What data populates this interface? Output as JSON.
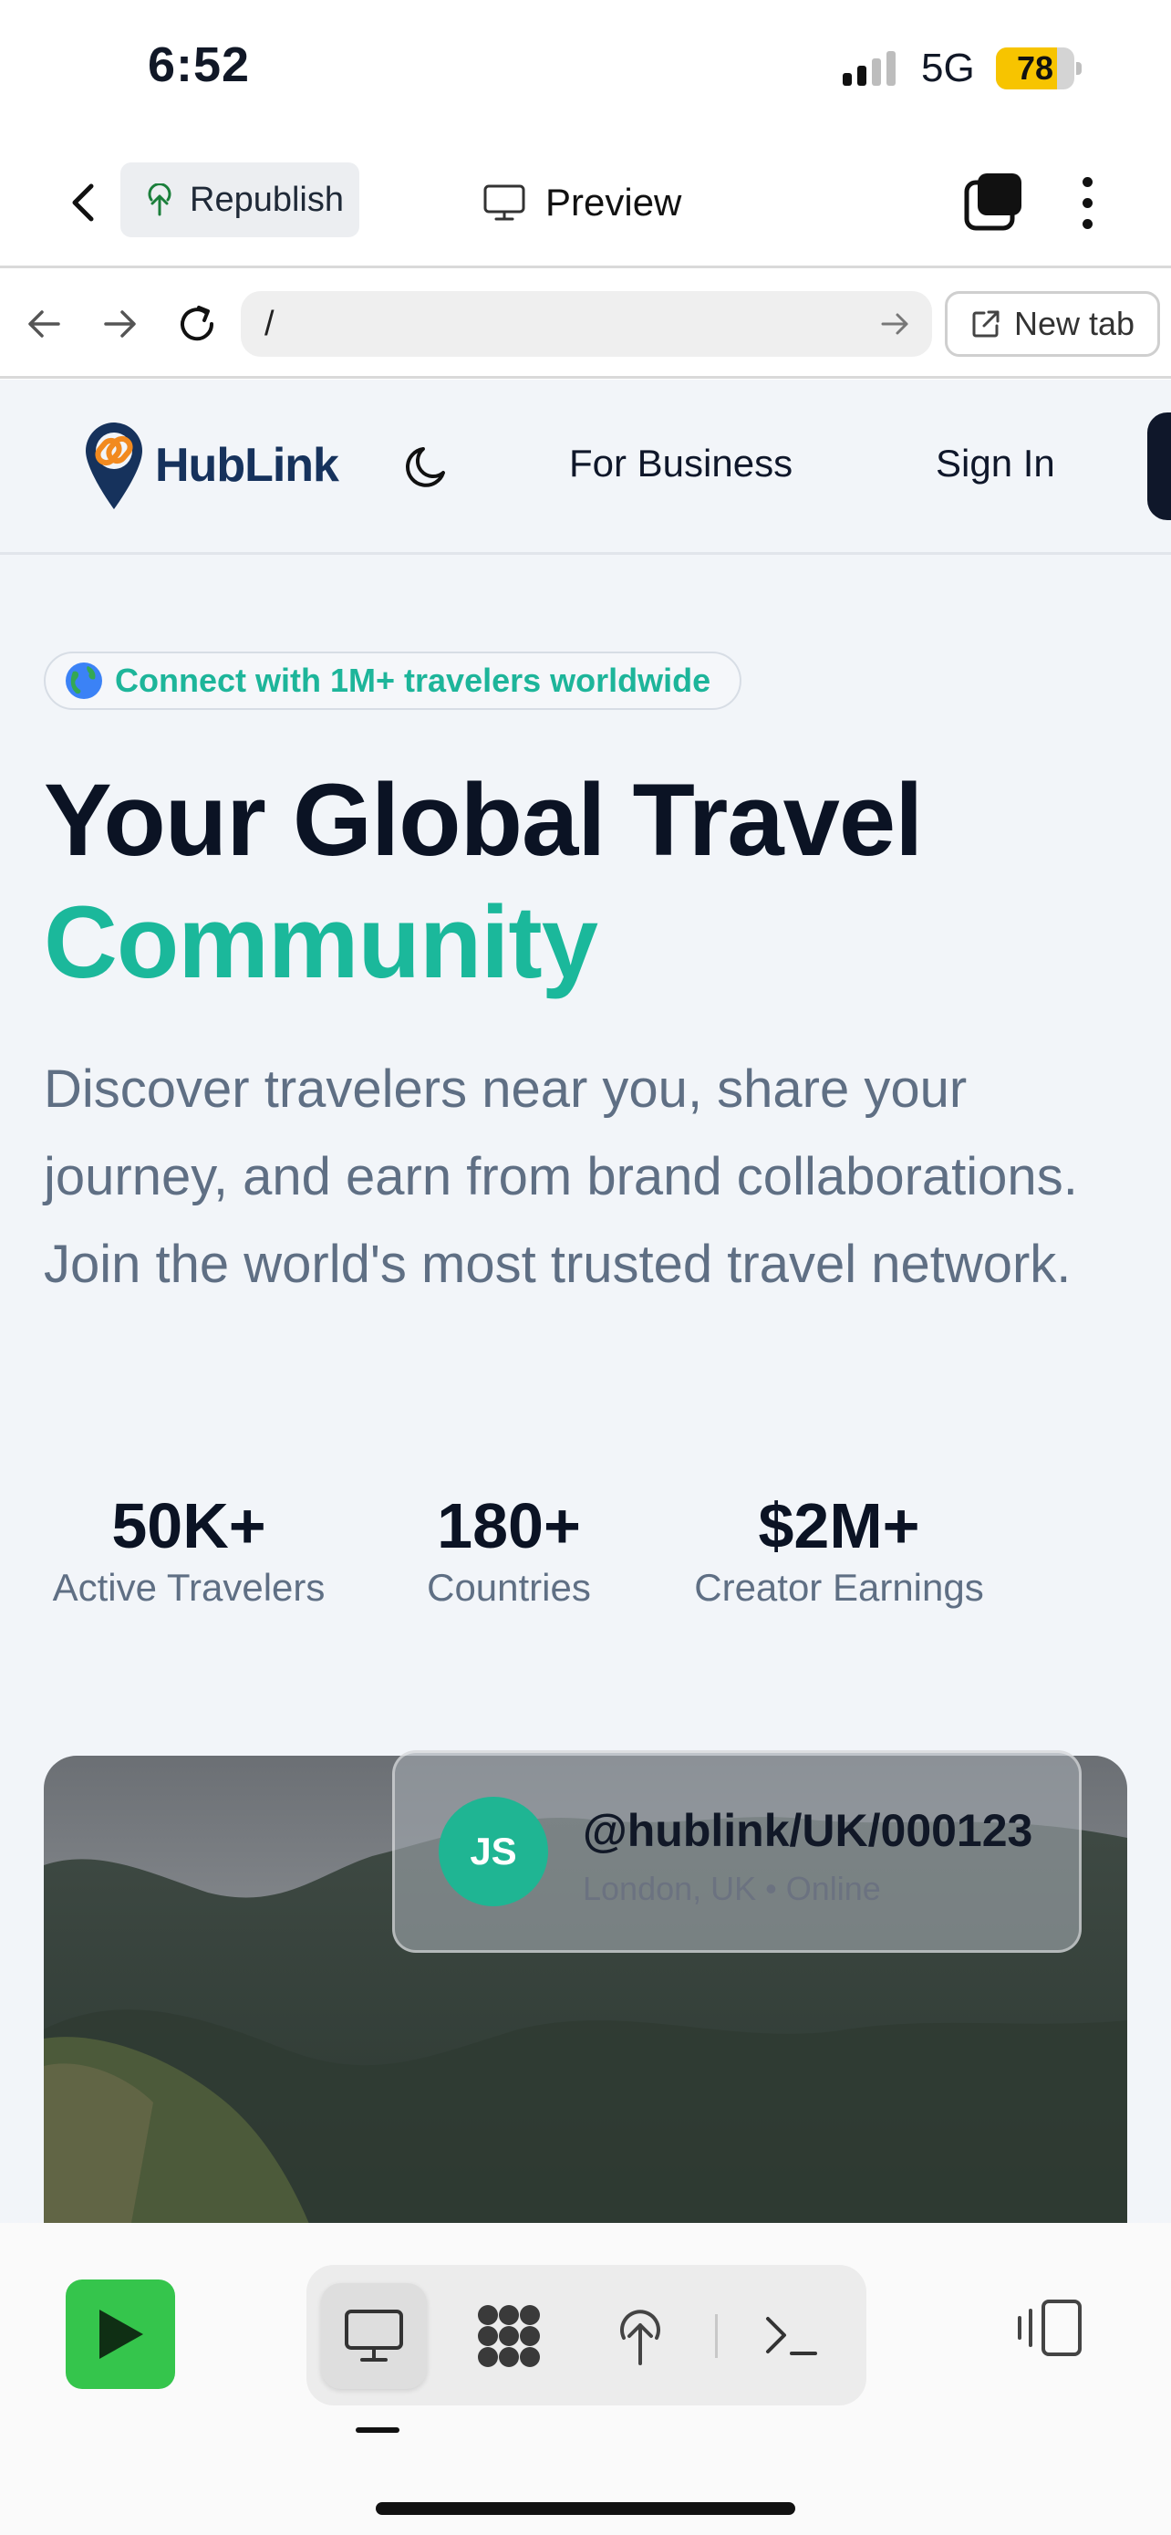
{
  "status_bar": {
    "time": "6:52",
    "network": "5G",
    "battery": "78",
    "battery_level": 0.78
  },
  "app_bar": {
    "republish_label": "Republish",
    "preview_label": "Preview"
  },
  "browser": {
    "url": "/",
    "new_tab_label": "New tab"
  },
  "site": {
    "logo_text": "HubLink",
    "nav": {
      "business": "For Business",
      "sign_in": "Sign In"
    },
    "badge": "Connect with 1M+ travelers worldwide",
    "hero_title_line1": "Your Global Travel",
    "hero_title_line2": "Community",
    "hero_subtitle": "Discover travelers near you, share your journey, and earn from brand collaborations. Join the world's most trusted travel network.",
    "stats": [
      {
        "value": "50K+",
        "label": "Active Travelers"
      },
      {
        "value": "180+",
        "label": "Countries"
      },
      {
        "value": "$2M+",
        "label": "Creator Earnings"
      }
    ],
    "profile_card": {
      "initials": "JS",
      "handle": "@hublink/UK/000123",
      "location": "London, UK • Online"
    }
  },
  "colors": {
    "accent": "#1bb89b",
    "brand_navy": "#16325c",
    "run_green": "#35c54c",
    "battery_yellow": "#f7c400"
  },
  "toolbar": {
    "tools": [
      "monitor-icon",
      "grid-icon",
      "deploy-icon",
      "terminal-icon"
    ]
  }
}
